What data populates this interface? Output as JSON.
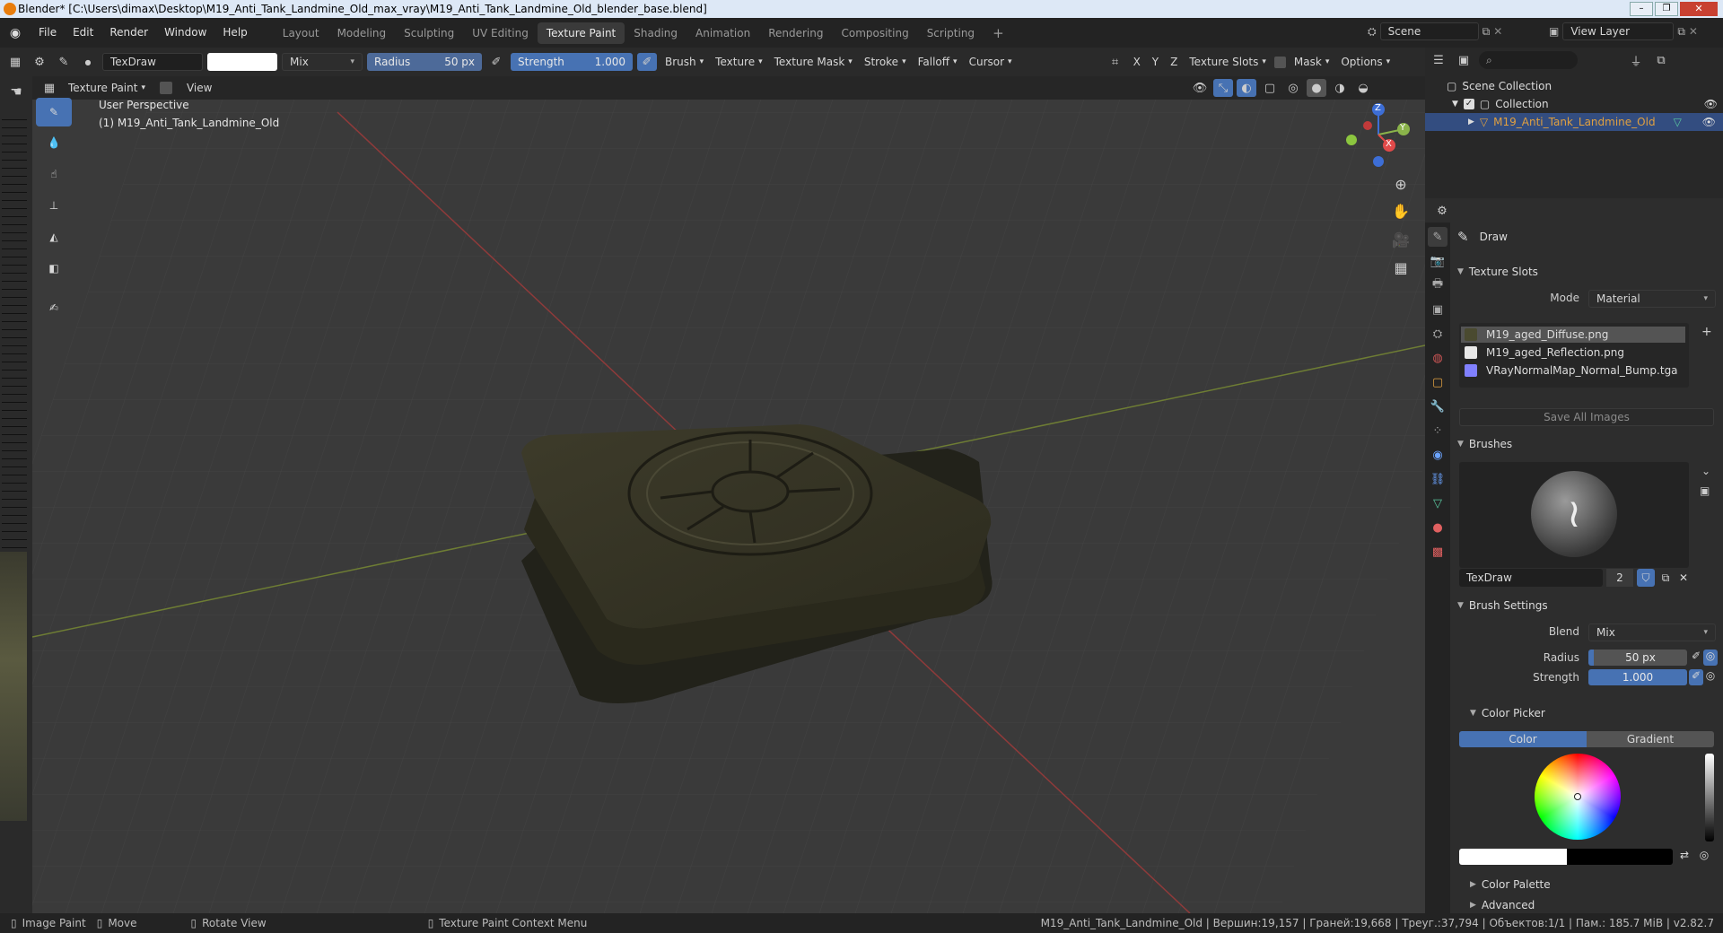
{
  "window": {
    "title": "Blender* [C:\\Users\\dimax\\Desktop\\M19_Anti_Tank_Landmine_Old_max_vray\\M19_Anti_Tank_Landmine_Old_blender_base.blend]"
  },
  "menu": {
    "items": [
      "File",
      "Edit",
      "Render",
      "Window",
      "Help"
    ],
    "workspaces": [
      "Layout",
      "Modeling",
      "Sculpting",
      "UV Editing",
      "Texture Paint",
      "Shading",
      "Animation",
      "Rendering",
      "Compositing",
      "Scripting"
    ],
    "active_workspace": "Texture Paint",
    "add": "+",
    "scene_label": "Scene",
    "view_layer_label": "View Layer"
  },
  "tool_header": {
    "brush_name": "TexDraw",
    "blend": "Mix",
    "radius_label": "Radius",
    "radius_value": "50 px",
    "strength_label": "Strength",
    "strength_value": "1.000",
    "menus": [
      "Brush",
      "Texture",
      "Texture Mask",
      "Stroke",
      "Falloff",
      "Cursor"
    ],
    "axes": [
      "X",
      "Y",
      "Z"
    ],
    "texture_slots": "Texture Slots",
    "mask": "Mask",
    "options": "Options"
  },
  "viewport": {
    "mode": "Texture Paint",
    "view_menu": "View",
    "perspective": "User Perspective",
    "object_label": "(1) M19_Anti_Tank_Landmine_Old",
    "gizmo": {
      "x": "X",
      "y": "Y",
      "z": "Z"
    }
  },
  "outliner": {
    "scene_collection": "Scene Collection",
    "collection": "Collection",
    "object": "M19_Anti_Tank_Landmine_Old"
  },
  "properties": {
    "tool_name": "Draw",
    "texture_slots": {
      "title": "Texture Slots",
      "mode_label": "Mode",
      "mode_value": "Material",
      "slots": [
        {
          "name": "M19_aged_Diffuse.png",
          "color": "#4a4a30"
        },
        {
          "name": "M19_aged_Reflection.png",
          "color": "#e8e8e8"
        },
        {
          "name": "VRayNormalMap_Normal_Bump.tga",
          "color": "#8080ff"
        }
      ],
      "save_all": "Save All Images"
    },
    "brushes": {
      "title": "Brushes",
      "name": "TexDraw",
      "users": "2"
    },
    "brush_settings": {
      "title": "Brush Settings",
      "blend_label": "Blend",
      "blend_value": "Mix",
      "radius_label": "Radius",
      "radius_value": "50 px",
      "strength_label": "Strength",
      "strength_value": "1.000"
    },
    "color_picker": {
      "title": "Color Picker",
      "tab_color": "Color",
      "tab_gradient": "Gradient"
    },
    "color_palette": "Color Palette",
    "advanced": "Advanced"
  },
  "status": {
    "image_paint": "Image Paint",
    "move": "Move",
    "rotate": "Rotate View",
    "context": "Texture Paint Context Menu",
    "stats": "M19_Anti_Tank_Landmine_Old | Вершин:19,157 | Граней:19,668 | Треуг.:37,794 | Объектов:1/1 | Пам.: 185.7 MiB | v2.82.7"
  },
  "colors": {
    "accent": "#4772b3",
    "active_object": "#e0a040"
  }
}
